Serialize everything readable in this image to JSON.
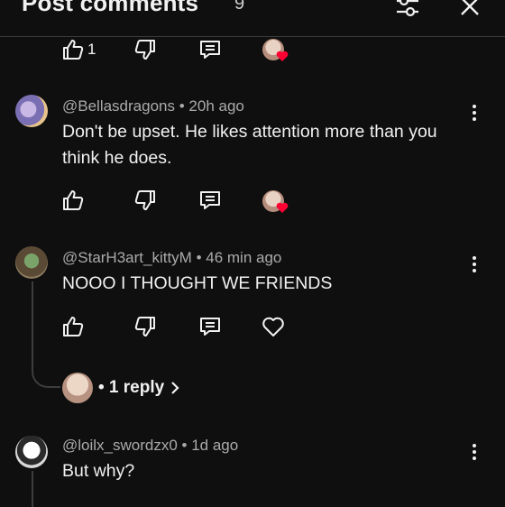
{
  "header": {
    "title": "Post comments",
    "count": "9",
    "filter_icon": "sliders-icon",
    "close_icon": "close-icon"
  },
  "top_actions": {
    "like_count": "1"
  },
  "comments": [
    {
      "author": "@Bellasdragons",
      "time": "• 20h ago",
      "text": "Don't be upset. He likes attention more than you think he does."
    },
    {
      "author": "@StarH3art_kittyM",
      "time": "• 46 min ago",
      "text": "NOOO I THOUGHT WE FRIENDS",
      "replies_label": "• 1 reply"
    },
    {
      "author": "@loilx_swordzx0",
      "time": "• 1d ago",
      "text": "But why?"
    }
  ],
  "colors": {
    "background": "#0f0f0f",
    "text": "#f1f1f1",
    "muted": "#aaaaaa",
    "heart": "#ff0033"
  }
}
